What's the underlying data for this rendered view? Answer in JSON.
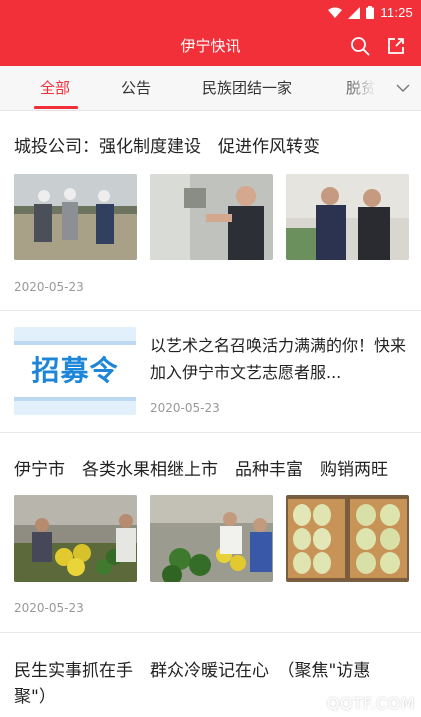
{
  "status_bar": {
    "time": "11:25"
  },
  "app_bar": {
    "title": "伊宁快讯"
  },
  "tabs": [
    {
      "label": "全部",
      "active": true
    },
    {
      "label": "公告",
      "active": false
    },
    {
      "label": "民族团结一家",
      "active": false
    },
    {
      "label": "脱贫",
      "active": false
    }
  ],
  "feed": [
    {
      "title": "城投公司：强化制度建设　促进作风转变",
      "date": "2020-05-23"
    },
    {
      "image_text": "招募令",
      "title": "以艺术之名召唤活力满满的你！快来加入伊宁市文艺志愿者服...",
      "date": "2020-05-23"
    },
    {
      "title": "伊宁市　各类水果相继上市　品种丰富　购销两旺",
      "date": "2020-05-23"
    },
    {
      "title_line1": "民生实事抓在手　群众冷暖记在心　（聚焦\"访惠",
      "title_line2": "聚\"）"
    }
  ],
  "watermark": "QQTF.COM",
  "colors": {
    "accent": "#f2303a",
    "date": "#999999",
    "tab_bg": "#f7f7f7"
  }
}
